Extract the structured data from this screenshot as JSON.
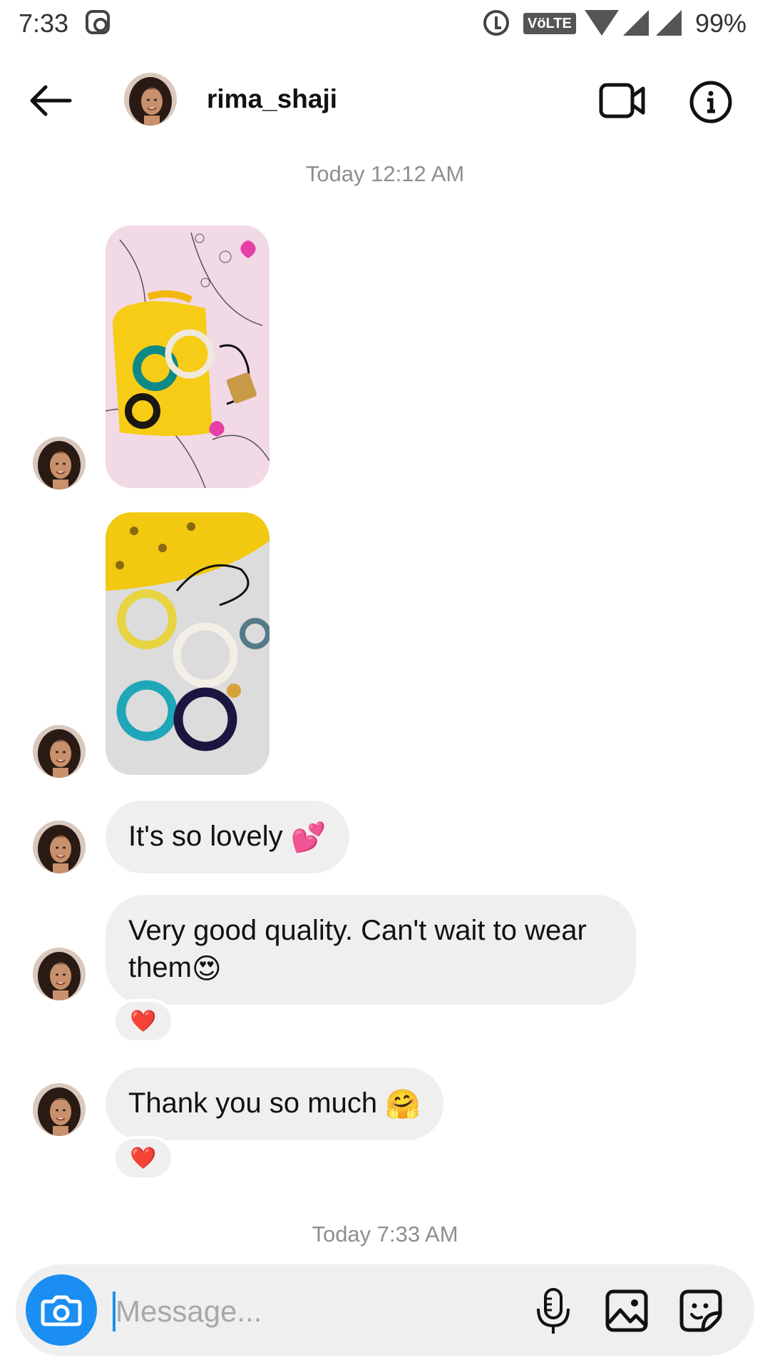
{
  "status_bar": {
    "time": "7:33",
    "network_badge": "VöLTE",
    "battery": "99%"
  },
  "header": {
    "username": "rima_shaji"
  },
  "icons": {
    "back": "arrow-left-icon",
    "video_call": "video-camera-icon",
    "info": "info-icon",
    "camera": "camera-icon",
    "mic": "microphone-icon",
    "gallery": "image-icon",
    "sticker": "sticker-icon"
  },
  "conversation": {
    "timestamp_1": "Today 12:12 AM",
    "messages": [
      {
        "type": "photo",
        "subject": "bracelets on yellow pouch"
      },
      {
        "type": "photo",
        "subject": "bracelets with pearls and beads"
      },
      {
        "type": "text",
        "text": "It's so lovely",
        "emoji": "💕"
      },
      {
        "type": "text",
        "text": "Very good quality. Can't wait to wear them",
        "emoji": "😍",
        "reaction": "❤️"
      },
      {
        "type": "text",
        "text": "Thank you so much",
        "emoji": "🤗",
        "reaction": "❤️"
      }
    ],
    "timestamp_2": "Today 7:33 AM"
  },
  "composer": {
    "placeholder": "Message..."
  },
  "colors": {
    "accent": "#1a8ef2",
    "bubble": "#efefef",
    "timestamp": "#8e8e8e",
    "heart": "#e0162b"
  }
}
